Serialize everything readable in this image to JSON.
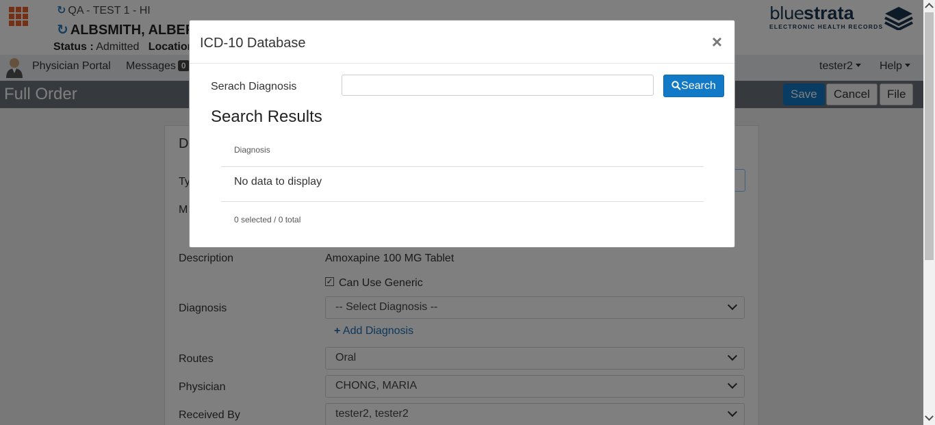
{
  "header": {
    "env": "QA - TEST 1 - HI",
    "patient_name": "ALBSMITH, ALBERT",
    "status_label": "Status :",
    "status_value": "Admitted",
    "location_label": "Location"
  },
  "logo": {
    "text_thin": "blue",
    "text_bold": "strata",
    "subtitle": "ELECTRONIC HEALTH RECORDS"
  },
  "nav": {
    "portal": "Physician Portal",
    "messages": "Messages",
    "messages_count": "0",
    "user": "tester2",
    "help": "Help"
  },
  "titlebar": {
    "title": "Full Order",
    "save": "Save",
    "cancel": "Cancel",
    "file": "File"
  },
  "form": {
    "section_letter": "D",
    "type_label": "Ty",
    "m_label": "M",
    "description_label": "Description",
    "description_value": "Amoxapine 100 MG Tablet",
    "generic_label": "Can Use Generic",
    "generic_checked": true,
    "diagnosis_label": "Diagnosis",
    "diagnosis_value": "-- Select Diagnosis --",
    "add_diagnosis": "Add Diagnosis",
    "routes_label": "Routes",
    "routes_value": "Oral",
    "physician_label": "Physician",
    "physician_value": "CHONG, MARIA",
    "received_label": "Received By",
    "received_value": "tester2, tester2"
  },
  "modal": {
    "title": "ICD-10 Database",
    "close": "×",
    "search_label": "Serach Diagnosis",
    "search_value": "",
    "search_button": "Search",
    "results_heading": "Search Results",
    "column": "Diagnosis",
    "empty_text": "No data to display",
    "count_text": "0 selected / 0 total"
  },
  "colors": {
    "accent": "#1279c6",
    "apps": "#e8632b",
    "logo": "#1b3550"
  }
}
